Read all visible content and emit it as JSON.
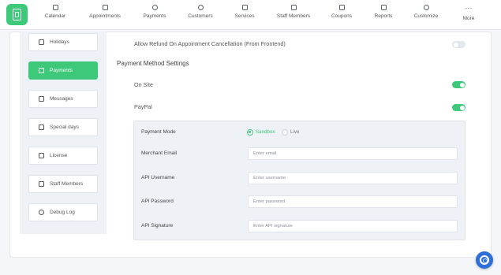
{
  "nav": {
    "items": [
      {
        "label": "Calendar",
        "icon": "calendar-icon"
      },
      {
        "label": "Appointments",
        "icon": "appointments-icon"
      },
      {
        "label": "Payments",
        "icon": "payments-icon"
      },
      {
        "label": "Customers",
        "icon": "customers-icon"
      },
      {
        "label": "Services",
        "icon": "services-icon"
      },
      {
        "label": "Staff Members",
        "icon": "staff-members-icon"
      },
      {
        "label": "Coupons",
        "icon": "coupons-icon"
      },
      {
        "label": "Reports",
        "icon": "reports-icon"
      },
      {
        "label": "Customize",
        "icon": "customize-icon"
      },
      {
        "label": "More",
        "icon": "more-dots-icon"
      }
    ]
  },
  "sidebar": {
    "items": [
      {
        "label": "Holidays",
        "icon": "holidays-icon",
        "active": false
      },
      {
        "label": "Payments",
        "icon": "payments-icon",
        "active": true
      },
      {
        "label": "Messages",
        "icon": "messages-icon",
        "active": false
      },
      {
        "label": "Special days",
        "icon": "special-days-icon",
        "active": false
      },
      {
        "label": "License",
        "icon": "license-icon",
        "active": false
      },
      {
        "label": "Staff Members",
        "icon": "staff-members-icon",
        "active": false
      },
      {
        "label": "Debug Log",
        "icon": "debug-log-icon",
        "active": false
      }
    ]
  },
  "settings": {
    "refund_label": "Allow Refund On Appointment Cancellation (From Frontend)",
    "refund_enabled": false,
    "section_title": "Payment Method Settings",
    "on_site_label": "On Site",
    "on_site_enabled": true,
    "paypal_label": "PayPal",
    "paypal_enabled": true
  },
  "paypal": {
    "mode_label": "Payment Mode",
    "mode_options": [
      "Sandbox",
      "Live"
    ],
    "mode_selected": "Sandbox",
    "fields": [
      {
        "label": "Merchant Email",
        "placeholder": "Enter email",
        "value": ""
      },
      {
        "label": "API Username",
        "placeholder": "Enter username",
        "value": ""
      },
      {
        "label": "API Password",
        "placeholder": "Enter password",
        "value": ""
      },
      {
        "label": "API Signature",
        "placeholder": "Enter API signature",
        "value": ""
      }
    ]
  },
  "colors": {
    "accent": "#3ec97a",
    "help_button": "#2f6fd9"
  }
}
